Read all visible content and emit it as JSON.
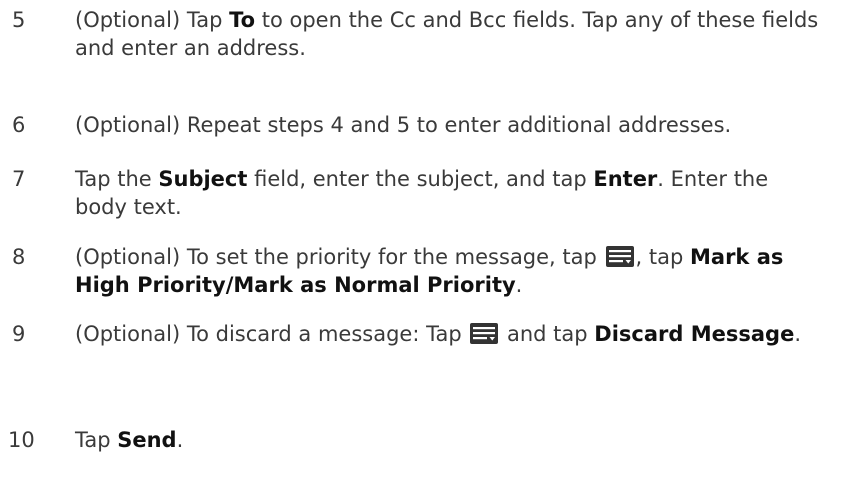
{
  "steps": [
    {
      "number": "5",
      "p1": "(Optional) Tap ",
      "b1": "To",
      "p2": " to open the Cc and Bcc fields. Tap any of these fields and enter an address."
    },
    {
      "number": "6",
      "p1": "(Optional) Repeat steps 4 and 5 to enter additional addresses."
    },
    {
      "number": "7",
      "p1": "Tap the ",
      "b1": "Subject",
      "p2": " field, enter the subject, and tap ",
      "b2": "Enter",
      "p3": ". Enter the body text."
    },
    {
      "number": "8",
      "p1": "(Optional) To set the priority for the message, tap ",
      "icon": "menu-icon",
      "p2": ", tap ",
      "b1": "Mark as High Priority",
      "sep": "/",
      "b2": "Mark as Normal Priority",
      "p3": "."
    },
    {
      "number": "9",
      "p1": "(Optional) To discard a message: Tap ",
      "icon": "menu-icon",
      "p2": " and tap ",
      "b1": "Discard Message",
      "p3": "."
    },
    {
      "number": "10",
      "p1": "Tap ",
      "b1": "Send",
      "p2": "."
    }
  ],
  "colors": {
    "text": "#3a3a3a",
    "bold": "#111111",
    "icon_bg": "#333333"
  }
}
